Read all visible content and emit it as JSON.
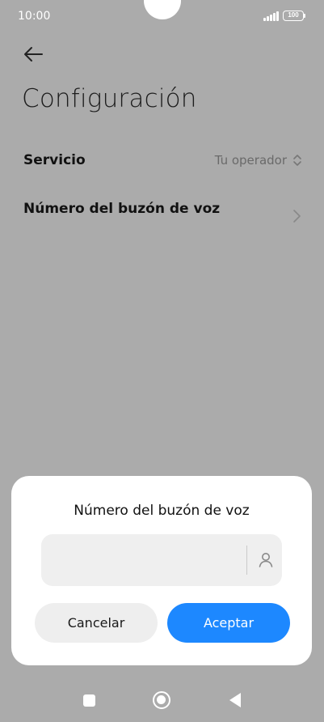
{
  "status_bar": {
    "time": "10:00",
    "battery": "100"
  },
  "header": {
    "title": "Configuración"
  },
  "settings": {
    "rows": [
      {
        "label": "Servicio",
        "value": "Tu operador"
      },
      {
        "label": "Número del buzón de voz",
        "value": ""
      }
    ]
  },
  "dialog": {
    "title": "Número del buzón de voz",
    "input_value": "",
    "input_placeholder": "",
    "cancel_label": "Cancelar",
    "ok_label": "Aceptar"
  },
  "colors": {
    "overlay": "#ababab",
    "accent": "#1d88ff"
  },
  "icons": {
    "back": "arrow-left-icon",
    "service_selector": "up-down-chevron-icon",
    "row_arrow": "chevron-right-icon",
    "contact": "person-icon",
    "nav_recent": "square-icon",
    "nav_home": "circle-icon",
    "nav_back": "triangle-left-icon"
  }
}
